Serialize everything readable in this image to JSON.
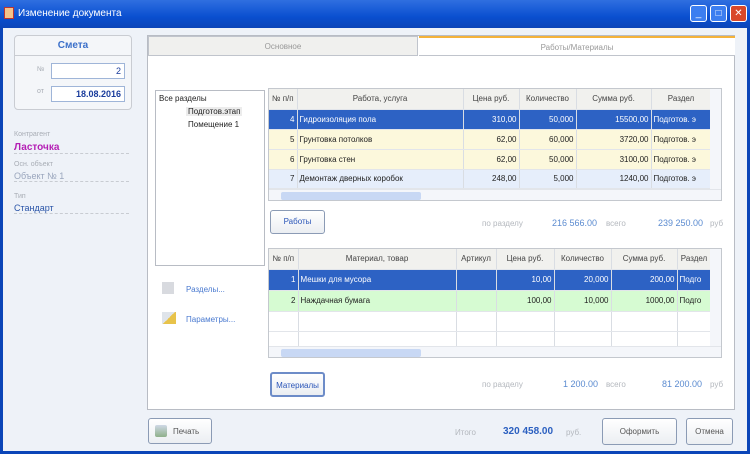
{
  "window": {
    "title": "Изменение документа",
    "min": "_",
    "max": "□",
    "close": "✕"
  },
  "left": {
    "doc_type": "Смета",
    "number_label": "№",
    "number": "2",
    "date_label": "от",
    "date": "18.08.2016",
    "counterparty_label": "Контрагент",
    "counterparty": "Ласточка",
    "object_label": "Осн. объект",
    "object": "Объект № 1",
    "type_label": "Тип",
    "type": "Стандарт"
  },
  "tabs": [
    {
      "label": "Основное"
    },
    {
      "label": "Работы/Материалы",
      "active": true
    }
  ],
  "tree": {
    "root": "Все разделы",
    "items": [
      "Подготов.этап",
      "Помещение 1"
    ]
  },
  "links": {
    "sections": "Разделы...",
    "params": "Параметры..."
  },
  "works": {
    "columns": [
      "№ п/п",
      "Работа, услуга",
      "Цена руб.",
      "Количество",
      "Сумма руб.",
      "Раздел"
    ],
    "rows": [
      [
        "4",
        "Гидроизоляция пола",
        "310,00",
        "50,000",
        "15500,00",
        "Подготов. э"
      ],
      [
        "5",
        "Грунтовка потолков",
        "62,00",
        "60,000",
        "3720,00",
        "Подготов. э"
      ],
      [
        "6",
        "Грунтовка стен",
        "62,00",
        "50,000",
        "3100,00",
        "Подготов. э"
      ],
      [
        "7",
        "Демонтаж дверных коробок",
        "248,00",
        "5,000",
        "1240,00",
        "Подготов. э"
      ]
    ],
    "button": "Работы",
    "by_section_label": "по разделу",
    "by_section": "216 566.00",
    "total_label": "всего",
    "total": "239 250.00",
    "currency": "руб"
  },
  "materials": {
    "columns": [
      "№ п/п",
      "Материал, товар",
      "Артикул",
      "Цена руб.",
      "Количество",
      "Сумма руб.",
      "Раздел"
    ],
    "rows": [
      [
        "1",
        "Мешки для мусора",
        "",
        "10,00",
        "20,000",
        "200,00",
        "Подго"
      ],
      [
        "2",
        "Наждачная бумага",
        "",
        "100,00",
        "10,000",
        "1000,00",
        "Подго"
      ]
    ],
    "button": "Материалы",
    "by_section_label": "по разделу",
    "by_section": "1 200.00",
    "total_label": "всего",
    "total": "81 200.00",
    "currency": "руб"
  },
  "footer": {
    "print": "Печать",
    "total_label": "Итого",
    "total": "320 458.00",
    "currency": "руб.",
    "submit": "Оформить",
    "cancel": "Отмена"
  }
}
